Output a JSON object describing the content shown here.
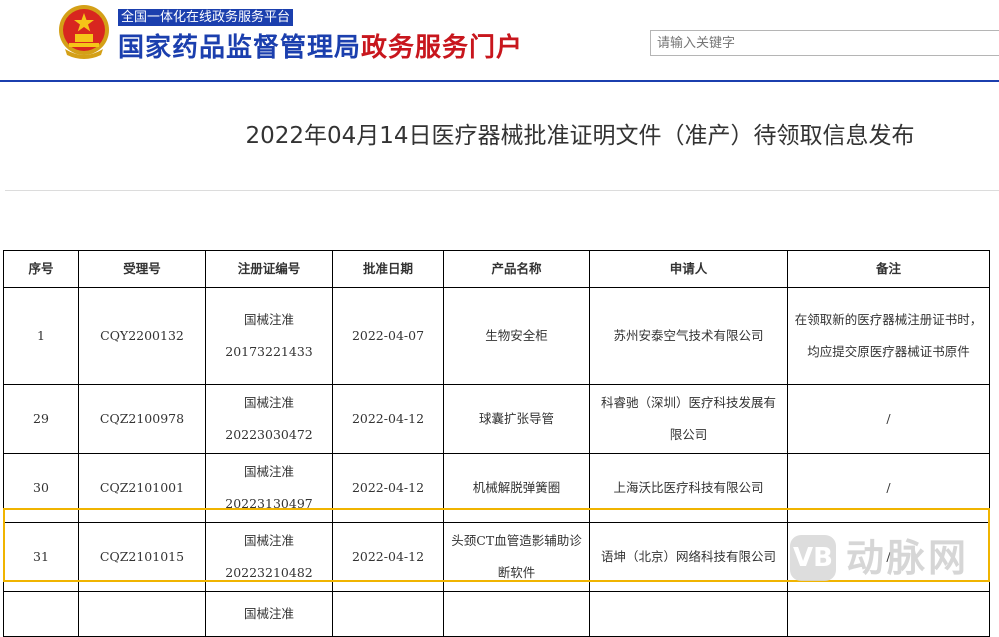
{
  "header": {
    "slogan": "全国一体化在线政务服务平台",
    "site_title_blue": "国家药品监督管理局",
    "site_title_red": "政务服务门户",
    "search_placeholder": "请输入关键字"
  },
  "page_title": "2022年04月14日医疗器械批准证明文件（准产）待领取信息发布",
  "table": {
    "headers": [
      "序号",
      "受理号",
      "注册证编号",
      "批准日期",
      "产品名称",
      "申请人",
      "备注"
    ],
    "rows": [
      {
        "no": "1",
        "accept_no": "CQY2200132",
        "reg_prefix": "国械注准",
        "reg_no": "20173221433",
        "date": "2022-04-07",
        "product": "生物安全柜",
        "applicant": "苏州安泰空气技术有限公司",
        "remark": "在领取新的医疗器械注册证书时，均应提交原医疗器械证书原件"
      },
      {
        "no": "29",
        "accept_no": "CQZ2100978",
        "reg_prefix": "国械注准",
        "reg_no": "20223030472",
        "date": "2022-04-12",
        "product": "球囊扩张导管",
        "applicant": "科睿驰（深圳）医疗科技发展有限公司",
        "remark": "/"
      },
      {
        "no": "30",
        "accept_no": "CQZ2101001",
        "reg_prefix": "国械注准",
        "reg_no": "20223130497",
        "date": "2022-04-12",
        "product": "机械解脱弹簧圈",
        "applicant": "上海沃比医疗科技有限公司",
        "remark": "/"
      },
      {
        "no": "31",
        "accept_no": "CQZ2101015",
        "reg_prefix": "国械注准",
        "reg_no": "20223210482",
        "date": "2022-04-12",
        "product": "头颈CT血管造影辅助诊断软件",
        "applicant": "语坤（北京）网络科技有限公司",
        "remark": "/"
      }
    ],
    "partial_row_prefix": "国械注准"
  },
  "watermark": {
    "icon": "VB",
    "text": "动脉网"
  },
  "colors": {
    "brand_blue": "#1b3fae",
    "brand_red": "#c8161d",
    "highlight": "#f0b400"
  },
  "icons": [
    "national-emblem-icon",
    "watermark-logo-icon"
  ]
}
